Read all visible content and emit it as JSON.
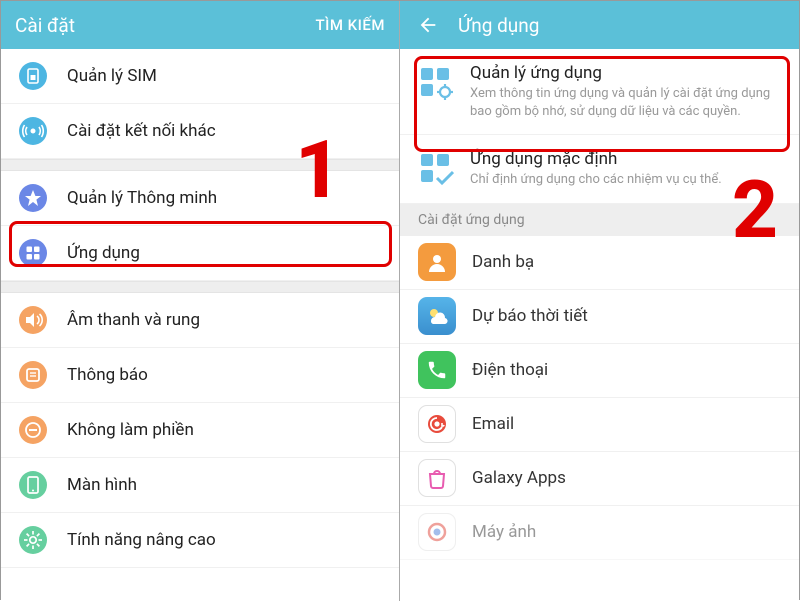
{
  "left": {
    "header": {
      "title": "Cài đặt",
      "action": "TÌM KIẾM"
    },
    "items": [
      {
        "label": "Quản lý SIM"
      },
      {
        "label": "Cài đặt kết nối khác"
      },
      {
        "label": "Quản lý Thông minh"
      },
      {
        "label": "Ứng dụng"
      },
      {
        "label": "Âm thanh và rung"
      },
      {
        "label": "Thông báo"
      },
      {
        "label": "Không làm phiền"
      },
      {
        "label": "Màn hình"
      },
      {
        "label": "Tính năng nâng cao"
      }
    ]
  },
  "right": {
    "header": {
      "title": "Ứng dụng"
    },
    "features": [
      {
        "title": "Quản lý ứng dụng",
        "sub": "Xem thông tin ứng dụng và quản lý cài đặt ứng dụng bao gồm bộ nhớ, sử dụng dữ liệu và các quyền."
      },
      {
        "title": "Ứng dụng mặc định",
        "sub": "Chỉ định ứng dụng cho các nhiệm vụ cụ thể."
      }
    ],
    "section": "Cài đặt ứng dụng",
    "apps": [
      {
        "label": "Danh bạ"
      },
      {
        "label": "Dự báo thời tiết"
      },
      {
        "label": "Điện thoại"
      },
      {
        "label": "Email"
      },
      {
        "label": "Galaxy Apps"
      },
      {
        "label": "Máy ảnh"
      }
    ]
  },
  "annotations": {
    "step1": "1",
    "step2": "2"
  }
}
